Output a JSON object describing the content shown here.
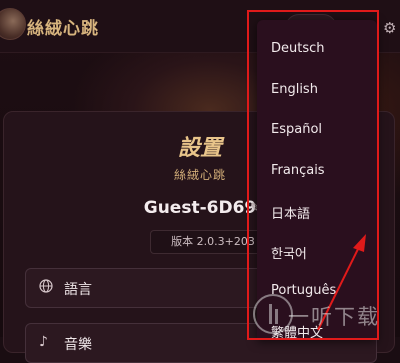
{
  "header": {
    "app_title": "絲絨心跳",
    "avatar_icon": "avatar",
    "settings_icon": "gear-icon"
  },
  "settings": {
    "title": "設置",
    "subtitle": "絲絨心跳",
    "username": "Guest-6D69",
    "version": "版本 2.0.3+203",
    "rows": [
      {
        "icon": "globe-icon",
        "label": "語言"
      },
      {
        "icon": "music-icon",
        "label": "音樂"
      }
    ]
  },
  "language_menu": {
    "items": [
      "Deutsch",
      "English",
      "Español",
      "Français",
      "日本語",
      "한국어",
      "Português",
      "繁體中文"
    ]
  },
  "watermark": {
    "text": "一听下载"
  },
  "colors": {
    "accent_gold": "#d7b47e",
    "dropdown_bg": "#2a0f1e",
    "annotation_red": "#e01a1a"
  }
}
